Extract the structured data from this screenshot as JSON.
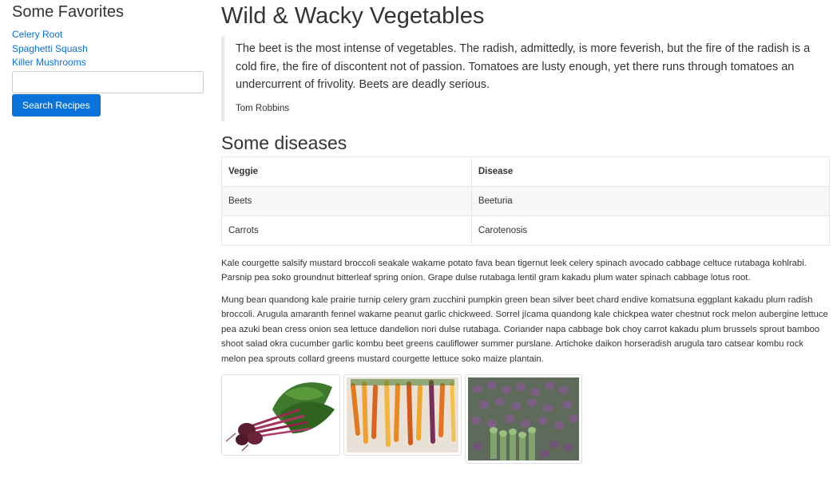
{
  "sidebar": {
    "heading": "Some Favorites",
    "favorites": [
      "Celery Root",
      "Spaghetti Squash",
      "Killer Mushrooms"
    ],
    "search": {
      "value": "",
      "placeholder": ""
    },
    "search_button_label": "Search Recipes"
  },
  "main": {
    "title": "Wild & Wacky Vegetables",
    "quote": {
      "text": "The beet is the most intense of vegetables. The radish, admittedly, is more feverish, but the fire of the radish is a cold fire, the fire of discontent not of passion. Tomatoes are lusty enough, yet there runs through tomatoes an undercurrent of frivolity. Beets are deadly serious.",
      "author": "Tom Robbins"
    },
    "diseases_heading": "Some diseases",
    "table": {
      "headers": [
        "Veggie",
        "Disease"
      ],
      "rows": [
        [
          "Beets",
          "Beeturia"
        ],
        [
          "Carrots",
          "Carotenosis"
        ]
      ]
    },
    "paragraphs": [
      "Kale courgette salsify mustard broccoli seakale wakame potato fava bean tigernut leek celery spinach avocado cabbage celtuce rutabaga kohlrabi. Parsnip pea soko groundnut bitterleaf spring onion. Grape dulse rutabaga lentil gram kakadu plum water spinach cabbage lotus root.",
      "Mung bean quandong kale prairie turnip celery gram zucchini pumpkin green bean silver beet chard endive komatsuna eggplant kakadu plum radish broccoli. Arugula amaranth fennel wakame peanut garlic chickweed. Sorrel jícama quandong kale chickpea water chestnut rock melon aubergine lettuce pea azuki bean cress onion sea lettuce dandelion nori dulse rutabaga. Coriander napa cabbage bok choy carrot kakadu plum brussels sprout bamboo shoot salad okra cucumber garlic kombu beet greens cauliflower summer purslane. Artichoke daikon horseradish arugula taro catsear kombu rock melon pea sprouts collard greens mustard courgette lettuce soko maize plantain."
    ],
    "images": [
      "beets-photo",
      "carrots-photo",
      "asparagus-photo"
    ]
  },
  "colors": {
    "link": "#0a6fd6",
    "button": "#0a74db",
    "text": "#333333"
  }
}
